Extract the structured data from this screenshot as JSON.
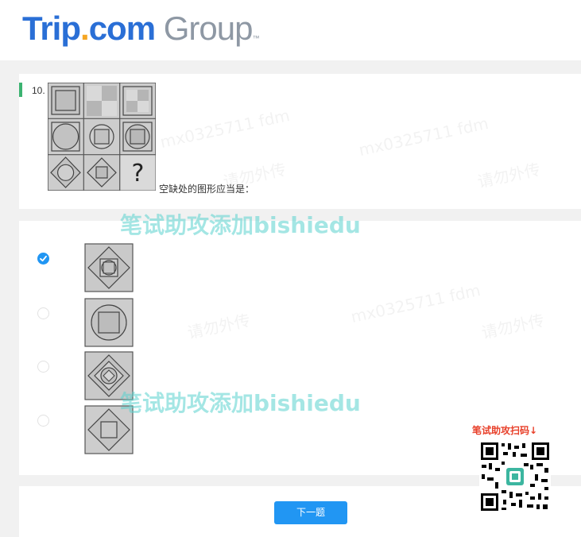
{
  "header": {
    "logo_trip": "Trip",
    "logo_dot": ".",
    "logo_com": "com",
    "logo_group": " Group",
    "logo_tm": "™"
  },
  "question": {
    "number": "10.",
    "prompt": "空缺处的图形应当是：",
    "missing_mark": "?"
  },
  "options": [
    {
      "selected": true
    },
    {
      "selected": false
    },
    {
      "selected": false
    },
    {
      "selected": false
    }
  ],
  "actions": {
    "next_label": "下一题"
  },
  "watermarks": {
    "line1": "笔试助攻添加bishiedu",
    "line2": "笔试助攻添加bishiedu",
    "ghost": "请勿外传",
    "ghost_id": "mx0325711 fdm"
  },
  "qr": {
    "label": "笔试助攻扫码↓"
  },
  "colors": {
    "accent": "#2196f3",
    "logo_blue": "#2a6fd6",
    "logo_orange": "#f5a623",
    "marker_green": "#3cb371",
    "watermark": "#5ad2cd",
    "qr_label": "#e8402a"
  }
}
